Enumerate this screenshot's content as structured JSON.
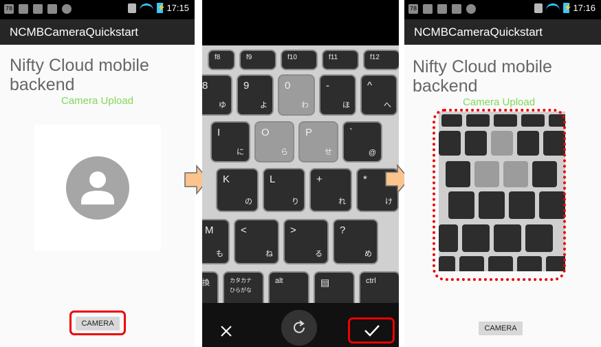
{
  "status_left": {
    "time": "17:15",
    "notice": "78"
  },
  "status_right": {
    "time": "17:16",
    "notice": "78"
  },
  "app": {
    "title": "NCMBCameraQuickstart",
    "heading": "Nifty Cloud mobile backend",
    "upload_label": "Camera Upload",
    "camera_button": "CAMERA"
  },
  "keyboard": {
    "rows": [
      [
        {
          "m": "f8",
          "s": ""
        },
        {
          "m": "f9",
          "s": ""
        },
        {
          "m": "f10",
          "s": ""
        },
        {
          "m": "f11",
          "s": ""
        },
        {
          "m": "f12",
          "s": ""
        }
      ],
      [
        {
          "m": "8",
          "s": "ゆ"
        },
        {
          "m": "9",
          "s": "よ"
        },
        {
          "m": "0",
          "s": "わ"
        },
        {
          "m": "-",
          "s": "ほ"
        },
        {
          "m": "^",
          "s": "へ"
        }
      ],
      [
        {
          "m": "I",
          "s": "に"
        },
        {
          "m": "O",
          "s": "ら"
        },
        {
          "m": "P",
          "s": "せ"
        },
        {
          "m": "`",
          "s": "@"
        }
      ],
      [
        {
          "m": "K",
          "s": "の"
        },
        {
          "m": "L",
          "s": "り"
        },
        {
          "m": "+",
          "s": "れ"
        },
        {
          "m": "*",
          "s": "け"
        }
      ],
      [
        {
          "m": "M",
          "s": "も"
        },
        {
          "m": "<",
          "s": "ね"
        },
        {
          "m": ">",
          "s": "る"
        },
        {
          "m": "?",
          "s": "め"
        }
      ],
      [
        {
          "m": "換",
          "s": ""
        },
        {
          "m": "カタカナ",
          "s": "ひらがな"
        },
        {
          "m": "alt",
          "s": ""
        },
        {
          "m": "▤",
          "s": ""
        },
        {
          "m": "ctrl",
          "s": ""
        }
      ]
    ]
  },
  "colors": {
    "accent_green": "#7ed957",
    "highlight_red": "#e00000",
    "arrow_fill": "#fbc38d",
    "arrow_stroke": "#6b6b6b"
  },
  "icons": {
    "close": "close-icon",
    "retake": "retake-icon",
    "confirm": "check-icon",
    "avatar": "person-placeholder-icon"
  }
}
